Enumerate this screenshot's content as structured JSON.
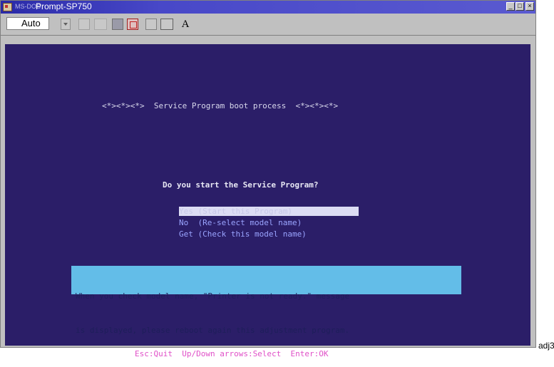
{
  "window": {
    "title_prefix": "MS-DOS",
    "title": "Prompt-SP750",
    "min_glyph": "_",
    "max_glyph": "□",
    "close_glyph": "×"
  },
  "toolbar": {
    "font_size_value": "Auto",
    "font_button": "A"
  },
  "screen": {
    "banner": "<*><*><*>  Service Program boot process  <*><*><*>",
    "question": "Do you start the Service Program?",
    "menu": [
      "Yes (Start this Program)",
      "No  (Re-select model name)",
      "Get (Check this model name)"
    ],
    "notice_line1": "When you check model name, \"Printer is not ready.\" message",
    "notice_line2": "is displayed, please reboot again this adjustment program.",
    "footer": "Esc:Quit  Up/Down arrows:Select  Enter:OK"
  },
  "caption": "adj3",
  "colors": {
    "screen_bg": "#2b1e68",
    "menu_text": "#9aa4ff",
    "notice_bg": "#63bde8",
    "footer_text": "#e050c8"
  }
}
